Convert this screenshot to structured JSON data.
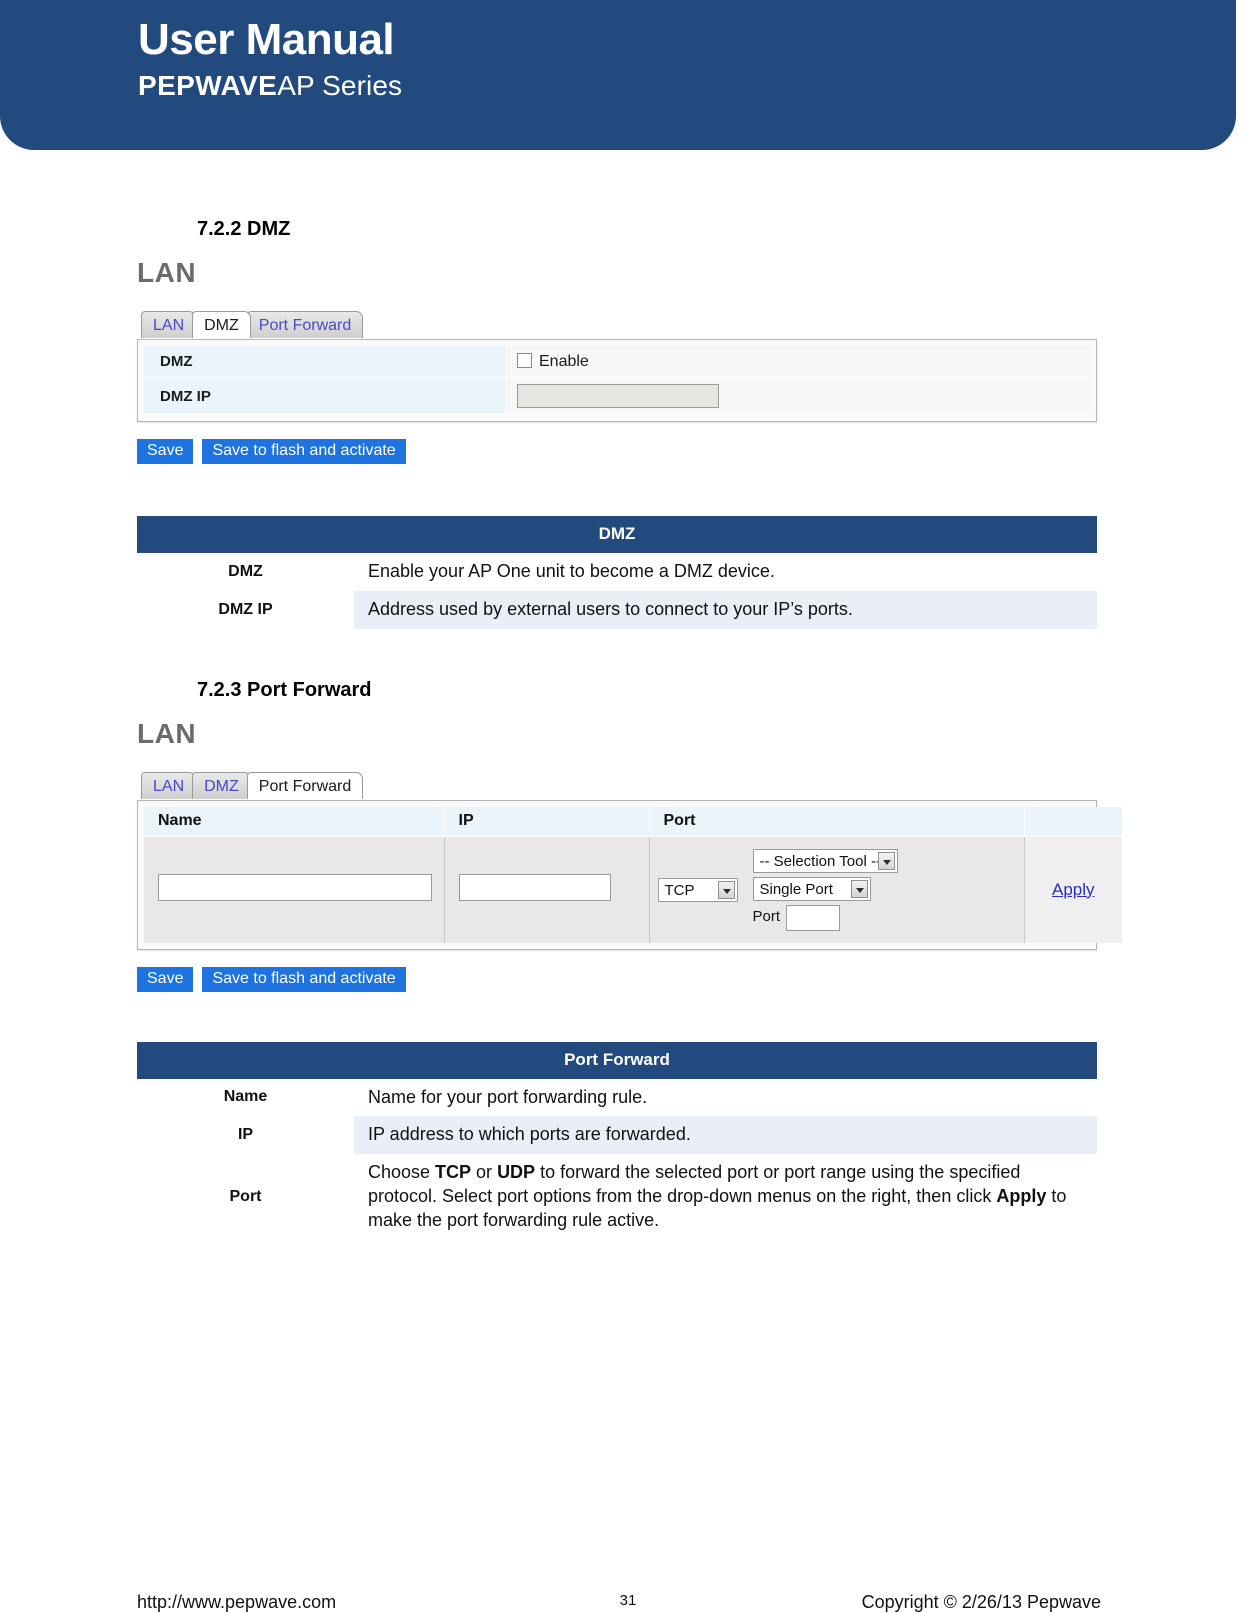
{
  "header": {
    "title": "User Manual",
    "brand_bold": "PEPWAVE",
    "brand_light": "AP Series"
  },
  "sections": [
    {
      "heading": "7.2.2 DMZ",
      "screenshot": {
        "panel_title": "LAN",
        "tabs": [
          {
            "label": "LAN",
            "active": false
          },
          {
            "label": "DMZ",
            "active": true
          },
          {
            "label": "Port Forward",
            "active": false
          }
        ],
        "form_rows": [
          {
            "label": "DMZ",
            "control": "checkbox",
            "checkbox_label": "Enable",
            "checked": false
          },
          {
            "label": "DMZ IP",
            "control": "textbox",
            "value": ""
          }
        ],
        "buttons": [
          {
            "label": "Save"
          },
          {
            "label": "Save to flash and activate"
          }
        ]
      },
      "table": {
        "header": "DMZ",
        "rows": [
          {
            "key": "DMZ",
            "value": "Enable your AP One unit to become a DMZ device."
          },
          {
            "key": "DMZ IP",
            "value": "Address used by external users to connect to your IP’s ports."
          }
        ]
      }
    },
    {
      "heading": "7.2.3 Port Forward",
      "screenshot": {
        "panel_title": "LAN",
        "tabs": [
          {
            "label": "LAN",
            "active": false
          },
          {
            "label": "DMZ",
            "active": false
          },
          {
            "label": "Port Forward",
            "active": true
          }
        ],
        "grid": {
          "columns": [
            "Name",
            "IP",
            "Port",
            ""
          ],
          "name_value": "",
          "ip_value": "",
          "protocol_select": "TCP",
          "selection_tool_select": "-- Selection Tool --",
          "port_mode_select": "Single Port",
          "port_label": "Port",
          "port_value": "",
          "apply_label": "Apply"
        },
        "buttons": [
          {
            "label": "Save"
          },
          {
            "label": "Save to flash and activate"
          }
        ]
      },
      "table": {
        "header": "Port Forward",
        "rows": [
          {
            "key": "Name",
            "value": "Name for your port forwarding rule."
          },
          {
            "key": "IP",
            "value": "IP address to which ports are forwarded."
          },
          {
            "key": "Port",
            "value_parts": [
              {
                "t": "Choose ",
                "b": false
              },
              {
                "t": "TCP",
                "b": true
              },
              {
                "t": " or ",
                "b": false
              },
              {
                "t": "UDP",
                "b": true
              },
              {
                "t": " to forward the selected port or port range using the specified protocol. Select port options from the drop-down menus on the right, then click ",
                "b": false
              },
              {
                "t": "Apply",
                "b": true
              },
              {
                "t": " to make the port forwarding rule active.",
                "b": false
              }
            ]
          }
        ]
      }
    }
  ],
  "footer": {
    "url": "http://www.pepwave.com",
    "page_number": "31",
    "copyright": "Copyright © 2/26/13 Pepwave"
  },
  "colors": {
    "brand_navy": "#224a7e",
    "button_blue": "#1d74e0",
    "tab_link_blue": "#4b46c8",
    "row_alt": "#eaeff7"
  }
}
